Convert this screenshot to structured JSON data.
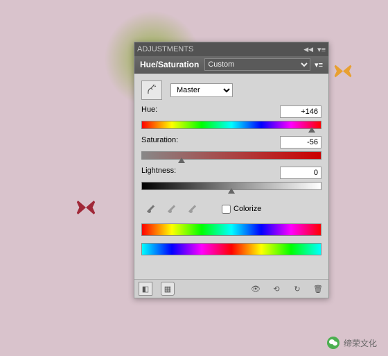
{
  "panel": {
    "title": "ADJUSTMENTS",
    "adjustment": "Hue/Saturation",
    "preset": "Custom",
    "range": "Master",
    "hue": {
      "label": "Hue:",
      "value": "+146"
    },
    "saturation": {
      "label": "Saturation:",
      "value": "-56"
    },
    "lightness": {
      "label": "Lightness:",
      "value": "0"
    },
    "colorize": "Colorize"
  },
  "caption": "缔荣文化",
  "chart_data": {
    "type": "sliders",
    "hue": {
      "min": -180,
      "max": 180,
      "value": 146
    },
    "saturation": {
      "min": -100,
      "max": 100,
      "value": -56
    },
    "lightness": {
      "min": -100,
      "max": 100,
      "value": 0
    }
  }
}
